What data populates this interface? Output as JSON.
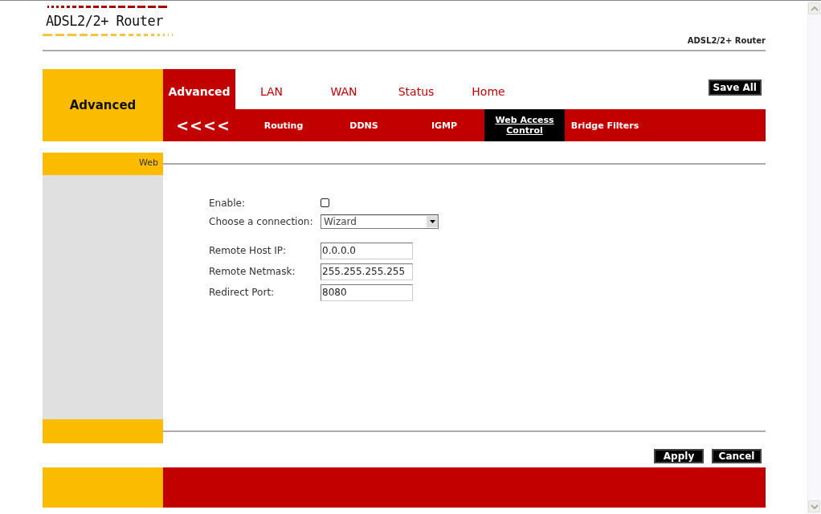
{
  "header": {
    "logo": "ADSL2/2+ Router",
    "product": "ADSL2/2+ Router"
  },
  "section_title": "Advanced",
  "tabs": [
    {
      "label": "Advanced",
      "selected": true
    },
    {
      "label": "LAN",
      "selected": false
    },
    {
      "label": "WAN",
      "selected": false
    },
    {
      "label": "Status",
      "selected": false
    },
    {
      "label": "Home",
      "selected": false
    }
  ],
  "save_button": "Save All",
  "back": "<<<<",
  "subtabs": [
    {
      "label": "Routing",
      "selected": false
    },
    {
      "label": "DDNS",
      "selected": false
    },
    {
      "label": "IGMP",
      "selected": false
    },
    {
      "label": "Web Access Control",
      "selected": true
    },
    {
      "label": "Bridge Filters",
      "selected": false
    }
  ],
  "sidebar": {
    "title": "Web"
  },
  "form": [
    {
      "kind": "checkbox",
      "label": "Enable:",
      "checked": false
    },
    {
      "kind": "select",
      "label": "Choose a connection:",
      "value": "Wizard"
    },
    {
      "kind": "text",
      "label": "Remote Host IP:",
      "value": "0.0.0.0"
    },
    {
      "kind": "text",
      "label": "Remote Netmask:",
      "value": "255.255.255.255"
    },
    {
      "kind": "text",
      "label": "Redirect Port:",
      "value": "8080"
    }
  ],
  "buttons": [
    "Apply",
    "Cancel"
  ]
}
